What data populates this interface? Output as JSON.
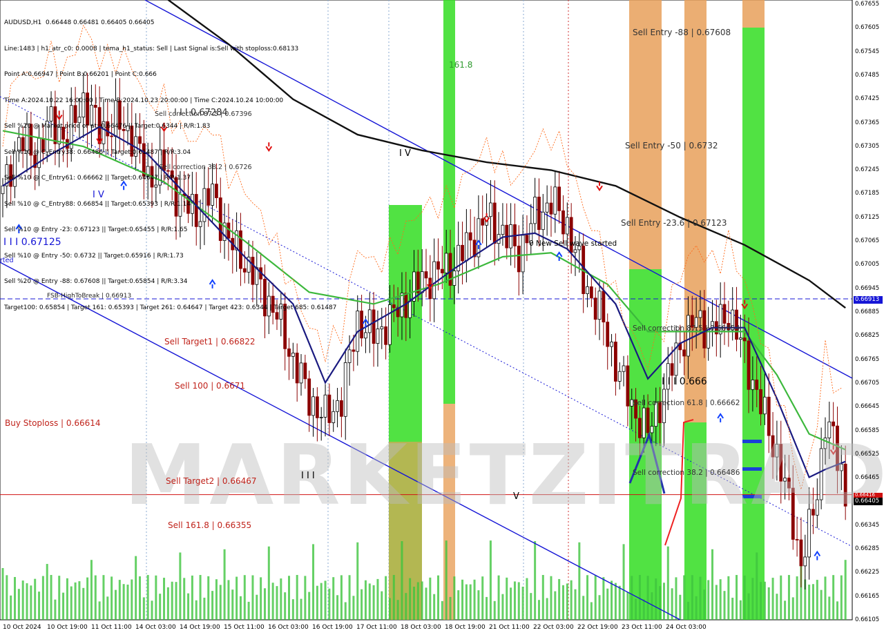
{
  "info_lines": [
    "AUDUSD,H1  0.66448 0.66481 0.66405 0.66405",
    "Line:1483 | h1_atr_c0: 0.0008 | tema_h1_status: Sell | Last Signal is:Sell with stoploss:0.68133",
    "Point A:0.66947 | Point B:0.66201 | Point C:0.666",
    "Time A:2024.10.22 16:00:00 | Time B:2024.10.23 20:00:00 | Time C:2024.10.24 10:00:00",
    "Sell %20 @ Market price or at: 0.66476 || Target:0.6344 | R/R:1.83",
    "Sell %10 @ C_Entry38: 0.66486 || Target:0.61487 | R/R:3.04",
    "Sell %10 @ C_Entry61: 0.66662 || Target:0.64647 | R/R:1.37",
    "Sell %10 @ C_Entry88: 0.66854 || Target:0.65393 | R/R:1.14",
    "Sell %10 @ Entry -23: 0.67123 || Target:0.65455 | R/R:1.65",
    "Sell %10 @ Entry -50: 0.6732 || Target:0.65916 | R/R:1.73",
    "Sell %20 @ Entry -88: 0.67608 || Target:0.65854 | R/R:3.34",
    "Target100: 0.65854 | Target 161: 0.65393 | Target 261: 0.64647 | Target 423: 0.6344 | Target 685: 0.61487"
  ],
  "annotations": {
    "sell_entry_88": "Sell Entry -88 | 0.67608",
    "sell_entry_50": "Sell Entry -50 | 0.6732",
    "sell_entry_236": "Sell Entry -23.6 | 0.67123",
    "sell_correction_875": "Sell correction 87.5 | 0.66854",
    "sell_correction_618": "Sell correction 61.8 | 0.66662",
    "sell_correction_382": "Sell correction 38.2 | 0.66486",
    "sell_target1": "Sell Target1 | 0.66822",
    "sell_100": "Sell 100 | 0.6671",
    "buy_stoploss": "Buy Stoploss | 0.66614",
    "sell_target2": "Sell Target2 | 0.66467",
    "sell_1618": "Sell 161.8 | 0.66355",
    "fsb": "FSB-HighToBreak | 0.66913",
    "new_sell_wave": "0 New Sell wave started",
    "fib_1618": "161.8",
    "wave_iiii_level": "I I I 0.67284",
    "wave_iii_0666": "I I I 0.666",
    "wave_left_level": "I I I 0.67125",
    "wave_IV": "I V",
    "wave_IV_2": "I V",
    "wave_III": "I I I",
    "wave_V": "V",
    "sell_correction_upper": "Sell correction 87.5 | 0.67396",
    "sell_correction_mid": "Sell correction 38.2 | 0.6726",
    "started_fragment": "rted"
  },
  "watermark": "MARKETZITRADE",
  "price_ticks": [
    "0.67655",
    "0.67605",
    "0.67545",
    "0.67485",
    "0.67425",
    "0.67365",
    "0.67305",
    "0.67245",
    "0.67185",
    "0.67125",
    "0.67065",
    "0.67005",
    "0.66945",
    "0.66885",
    "0.66825",
    "0.66765",
    "0.66705",
    "0.66645",
    "0.66585",
    "0.66525",
    "0.66465",
    "0.66405",
    "0.66345",
    "0.66285",
    "0.66225",
    "0.66165",
    "0.66105"
  ],
  "time_ticks": [
    "10 Oct 2024",
    "10 Oct 19:00",
    "11 Oct 11:00",
    "14 Oct 03:00",
    "14 Oct 19:00",
    "15 Oct 11:00",
    "16 Oct 03:00",
    "16 Oct 19:00",
    "17 Oct 11:00",
    "18 Oct 03:00",
    "18 Oct 19:00",
    "21 Oct 11:00",
    "22 Oct 03:00",
    "22 Oct 19:00",
    "23 Oct 11:00",
    "24 Oct 03:00"
  ],
  "price_tags": {
    "fsb": "0.66913",
    "current": "0.66405",
    "red_level": "0.66416"
  },
  "colors": {
    "bull_candle": "#000000",
    "bear_candle": "#8b0000",
    "ma_green": "#3cb83c",
    "ma_navy": "#1a1a80",
    "ma_black": "#111111",
    "channel": "#1515d6",
    "zone_green": "#33dd22",
    "zone_orange": "#e8a05a",
    "sell_arrow": "#e01010",
    "buy_arrow": "#1040ff",
    "fsb_line": "#1515d6",
    "current_line": "#d01010",
    "stops": "#ff6a1a"
  },
  "chart_data": {
    "type": "candlestick",
    "symbol": "AUDUSD",
    "timeframe": "H1",
    "title": "AUDUSD,H1",
    "ohlc_last": {
      "open": 0.66448,
      "high": 0.66481,
      "low": 0.66405,
      "close": 0.66405
    },
    "ylim": [
      0.66105,
      0.67665
    ],
    "x_categories": [
      "10 Oct 2024",
      "10 Oct 19:00",
      "11 Oct 11:00",
      "14 Oct 03:00",
      "14 Oct 19:00",
      "15 Oct 11:00",
      "16 Oct 03:00",
      "16 Oct 19:00",
      "17 Oct 11:00",
      "18 Oct 03:00",
      "18 Oct 19:00",
      "21 Oct 11:00",
      "22 Oct 03:00",
      "22 Oct 19:00",
      "23 Oct 11:00",
      "24 Oct 03:00"
    ],
    "close_path": [
      [
        0,
        0.6718
      ],
      [
        4,
        0.6732
      ],
      [
        8,
        0.6728
      ],
      [
        12,
        0.6736
      ],
      [
        16,
        0.6732
      ],
      [
        20,
        0.6742
      ],
      [
        24,
        0.6734
      ],
      [
        28,
        0.6736
      ],
      [
        32,
        0.6733
      ],
      [
        36,
        0.6722
      ],
      [
        40,
        0.6725
      ],
      [
        44,
        0.6716
      ],
      [
        48,
        0.6713
      ],
      [
        52,
        0.6718
      ],
      [
        56,
        0.6706
      ],
      [
        60,
        0.6701
      ],
      [
        64,
        0.6694
      ],
      [
        68,
        0.6687
      ],
      [
        72,
        0.6676
      ],
      [
        76,
        0.6666
      ],
      [
        80,
        0.6661
      ],
      [
        84,
        0.6666
      ],
      [
        88,
        0.6686
      ],
      [
        92,
        0.6682
      ],
      [
        96,
        0.6686
      ],
      [
        100,
        0.6691
      ],
      [
        104,
        0.6696
      ],
      [
        108,
        0.6698
      ],
      [
        112,
        0.67
      ],
      [
        116,
        0.6706
      ],
      [
        120,
        0.6712
      ],
      [
        124,
        0.6708
      ],
      [
        128,
        0.6703
      ],
      [
        132,
        0.6712
      ],
      [
        136,
        0.6716
      ],
      [
        140,
        0.671
      ],
      [
        144,
        0.6696
      ],
      [
        148,
        0.6688
      ],
      [
        152,
        0.6675
      ],
      [
        156,
        0.6664
      ],
      [
        160,
        0.6657
      ],
      [
        164,
        0.6668
      ],
      [
        168,
        0.668
      ],
      [
        172,
        0.6686
      ],
      [
        176,
        0.6683
      ],
      [
        180,
        0.6688
      ],
      [
        184,
        0.6677
      ],
      [
        188,
        0.6664
      ],
      [
        192,
        0.6652
      ],
      [
        196,
        0.6635
      ],
      [
        198,
        0.6624
      ],
      [
        200,
        0.6632
      ],
      [
        202,
        0.6643
      ],
      [
        204,
        0.666
      ],
      [
        206,
        0.6655
      ],
      [
        208,
        0.6648
      ],
      [
        209,
        0.66405
      ]
    ],
    "series": [
      {
        "name": "",
        "values": [
          [
            0,
            0.6734
          ],
          [
            20,
            0.673
          ],
          [
            40,
            0.6721
          ],
          [
            60,
            0.6706
          ],
          [
            76,
            0.6693
          ],
          [
            92,
            0.669
          ],
          [
            108,
            0.6695
          ],
          [
            124,
            0.6702
          ],
          [
            136,
            0.6703
          ],
          [
            150,
            0.6695
          ],
          [
            160,
            0.6683
          ],
          [
            172,
            0.6683
          ],
          [
            184,
            0.6683
          ],
          [
            192,
            0.6672
          ],
          [
            200,
            0.6657
          ],
          [
            209,
            0.6653
          ]
        ]
      },
      {
        "name": "",
        "values": [
          [
            0,
            0.672
          ],
          [
            12,
            0.6728
          ],
          [
            24,
            0.6735
          ],
          [
            36,
            0.6728
          ],
          [
            48,
            0.6715
          ],
          [
            60,
            0.6702
          ],
          [
            72,
            0.669
          ],
          [
            80,
            0.667
          ],
          [
            88,
            0.6683
          ],
          [
            100,
            0.669
          ],
          [
            112,
            0.6699
          ],
          [
            124,
            0.6707
          ],
          [
            132,
            0.6708
          ],
          [
            140,
            0.6704
          ],
          [
            152,
            0.669
          ],
          [
            160,
            0.6671
          ],
          [
            168,
            0.668
          ],
          [
            176,
            0.6684
          ],
          [
            184,
            0.6684
          ],
          [
            192,
            0.6666
          ],
          [
            200,
            0.6646
          ],
          [
            204,
            0.6648
          ],
          [
            209,
            0.665
          ]
        ]
      },
      {
        "name": "",
        "values": [
          [
            40,
            0.6768
          ],
          [
            56,
            0.6756
          ],
          [
            72,
            0.6742
          ],
          [
            88,
            0.6733
          ],
          [
            104,
            0.6729
          ],
          [
            120,
            0.6726
          ],
          [
            136,
            0.6724
          ],
          [
            152,
            0.672
          ],
          [
            168,
            0.6712
          ],
          [
            184,
            0.6705
          ],
          [
            200,
            0.6696
          ],
          [
            209,
            0.6689
          ]
        ]
      }
    ],
    "levels": {
      "fsb_high_to_break": 0.66913,
      "current_price": 0.66405,
      "red_line": 0.66416
    },
    "grid": true,
    "legend": "none"
  }
}
